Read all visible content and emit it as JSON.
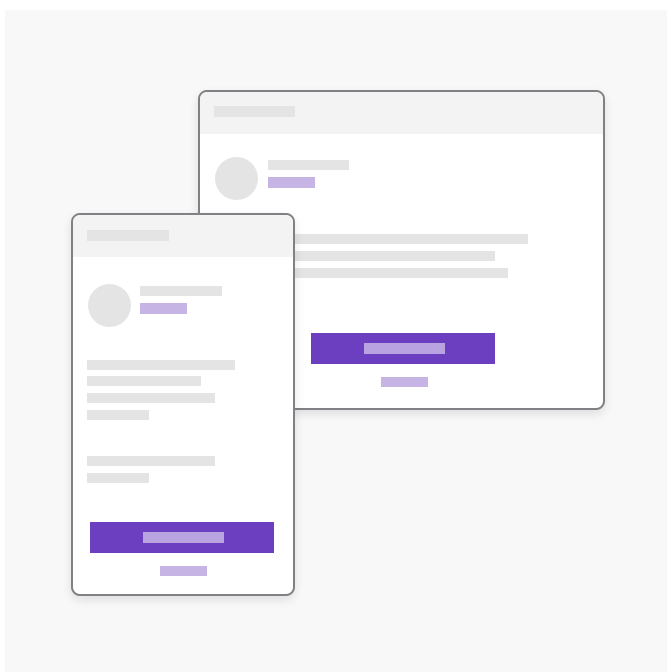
{
  "colors": {
    "background": "#f8f8f8",
    "window_border": "#808185",
    "titlebar": "#f3f3f3",
    "placeholder": "#e4e4e4",
    "accent_light": "#c6b4e4",
    "accent": "#6b3fbf"
  },
  "desktop_window": {
    "kind": "desktop",
    "placeholder_icon": "avatar-circle"
  },
  "mobile_window": {
    "kind": "mobile",
    "placeholder_icon": "avatar-circle"
  }
}
